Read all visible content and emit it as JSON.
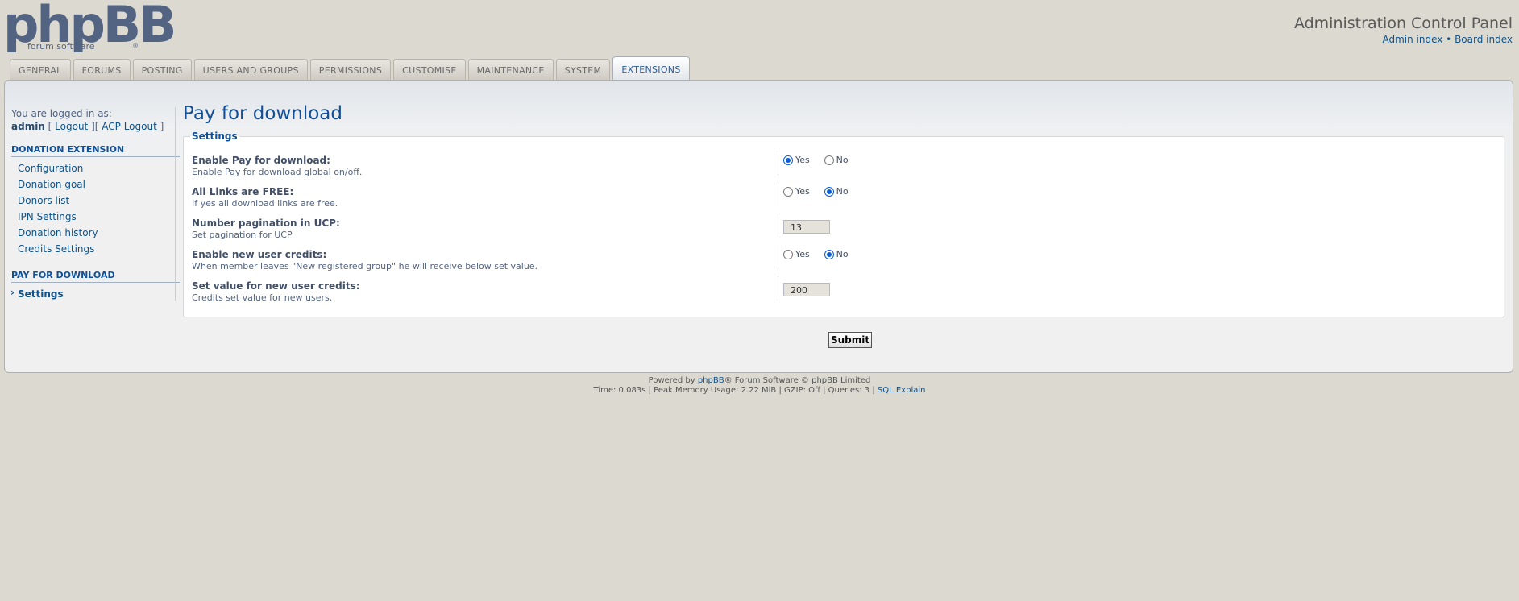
{
  "logo": {
    "main": "phpBB",
    "sub": "forum software",
    "mark": "®"
  },
  "header": {
    "title": "Administration Control Panel",
    "link_admin": "Admin index",
    "separator": "•",
    "link_board": "Board index"
  },
  "tabs": [
    "GENERAL",
    "FORUMS",
    "POSTING",
    "USERS AND GROUPS",
    "PERMISSIONS",
    "CUSTOMISE",
    "MAINTENANCE",
    "SYSTEM",
    "EXTENSIONS"
  ],
  "active_tab": "EXTENSIONS",
  "sidebar": {
    "login_prefix": "You are logged in as:",
    "username": "admin",
    "logout": "Logout",
    "acp_logout": "ACP Logout",
    "section1": "DONATION EXTENSION",
    "section1_items": [
      "Configuration",
      "Donation goal",
      "Donors list",
      "IPN Settings",
      "Donation history",
      "Credits Settings"
    ],
    "section2": "PAY FOR DOWNLOAD",
    "section2_items": [
      "Settings"
    ]
  },
  "main": {
    "title": "Pay for download",
    "legend": "Settings",
    "rows": [
      {
        "label": "Enable Pay for download:",
        "explain": "Enable Pay for download global on/off.",
        "type": "radio",
        "selected": "Yes"
      },
      {
        "label": "All Links are FREE:",
        "explain": "If yes all download links are free.",
        "type": "radio",
        "selected": "No"
      },
      {
        "label": "Number pagination in UCP:",
        "explain": "Set pagination for UCP",
        "type": "number",
        "value": "13"
      },
      {
        "label": "Enable new user credits:",
        "explain": "When member leaves \"New registered group\" he will receive below set value.",
        "type": "radio",
        "selected": "No"
      },
      {
        "label": "Set value for new user credits:",
        "explain": "Credits set value for new users.",
        "type": "number",
        "value": "200"
      }
    ],
    "yes": "Yes",
    "no": "No",
    "submit": "Submit"
  },
  "footer": {
    "powered_prefix": "Powered by",
    "powered_link": "phpBB",
    "powered_suffix": "® Forum Software © phpBB Limited",
    "stats": "Time: 0.083s | Peak Memory Usage: 2.22 MiB | GZIP: Off | Queries: 3 |",
    "sql_explain": "SQL Explain"
  },
  "colors": {
    "accent": "#115098",
    "link": "#105289",
    "background": "#dcd9d0",
    "radio_selected": "#0b5ed7"
  }
}
